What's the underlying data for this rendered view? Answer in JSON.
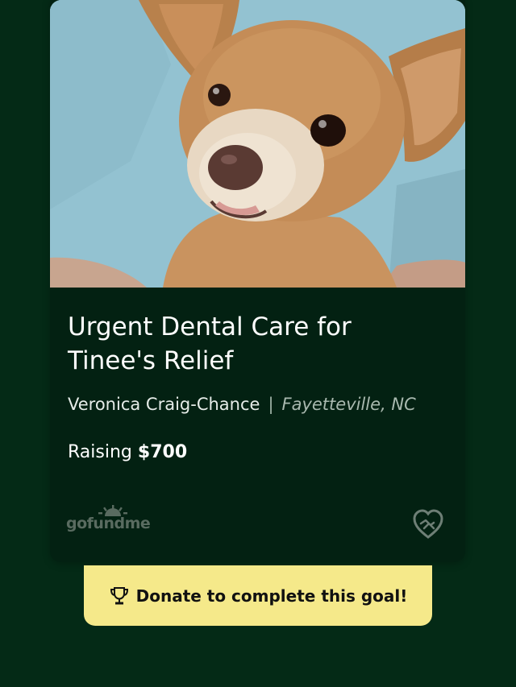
{
  "campaign": {
    "title": "Urgent Dental Care for Tinee's Relief",
    "organizer": "Veronica Craig-Chance",
    "separator": "|",
    "location": "Fayetteville, NC",
    "raising_label": "Raising",
    "raising_amount": "$700"
  },
  "brand": {
    "logo_text": "gofundme",
    "heart_icon": "heart-handshake-icon"
  },
  "cta": {
    "label": "Donate to complete this goal!",
    "icon": "trophy-icon"
  },
  "colors": {
    "background": "#042a16",
    "card": "#032112",
    "cta_background": "#f5e98a"
  }
}
